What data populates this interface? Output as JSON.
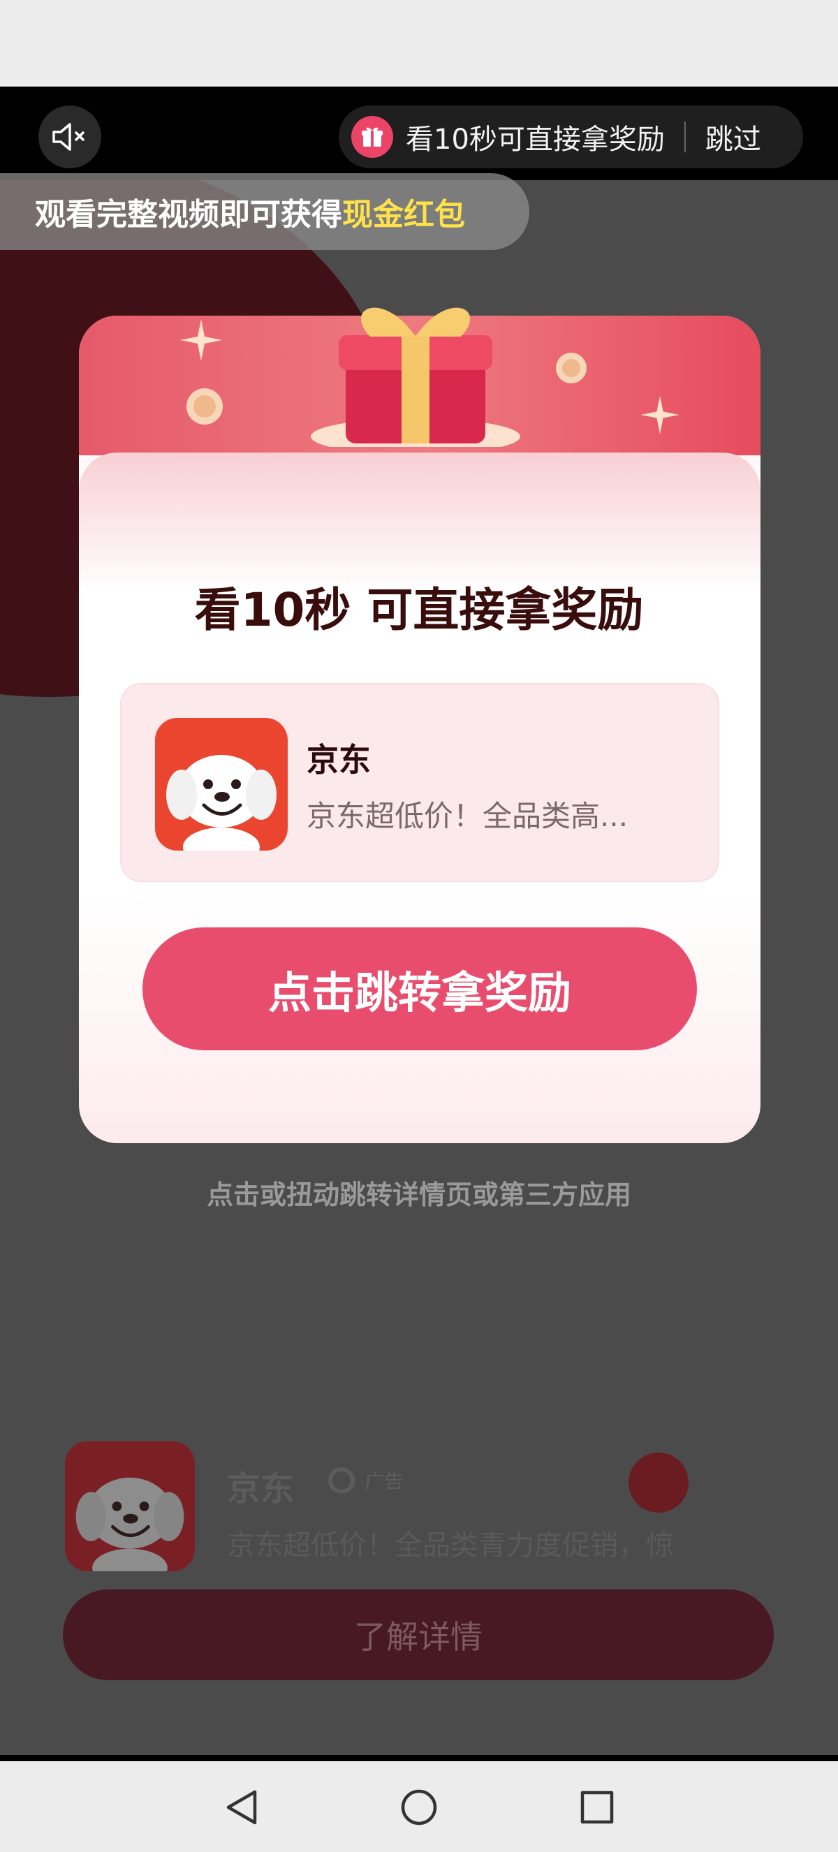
{
  "top_bar": {
    "mute_icon": "speaker-muted-icon",
    "reward_text": "看10秒可直接拿奖励",
    "skip_label": "跳过",
    "gift_icon": "gift-icon"
  },
  "banner": {
    "prefix": "观看完整视频即可获得",
    "highlight": "现金红包",
    "highlight_color": "#ffe14a"
  },
  "modal": {
    "title": "看10秒 可直接拿奖励",
    "app": {
      "name": "京东",
      "desc": "京东超低价！全品类高..."
    },
    "cta": "点击跳转拿奖励",
    "accent": "#e94d6e"
  },
  "hint": "点击或扭动跳转详情页或第三方应用",
  "ad": {
    "name": "京东",
    "badge": "广告",
    "desc": "京东超低价！全品类青力度促销，惊",
    "button": "了解详情"
  },
  "nav": {
    "back": "back-triangle-icon",
    "home": "home-circle-icon",
    "recents": "recents-square-icon"
  }
}
